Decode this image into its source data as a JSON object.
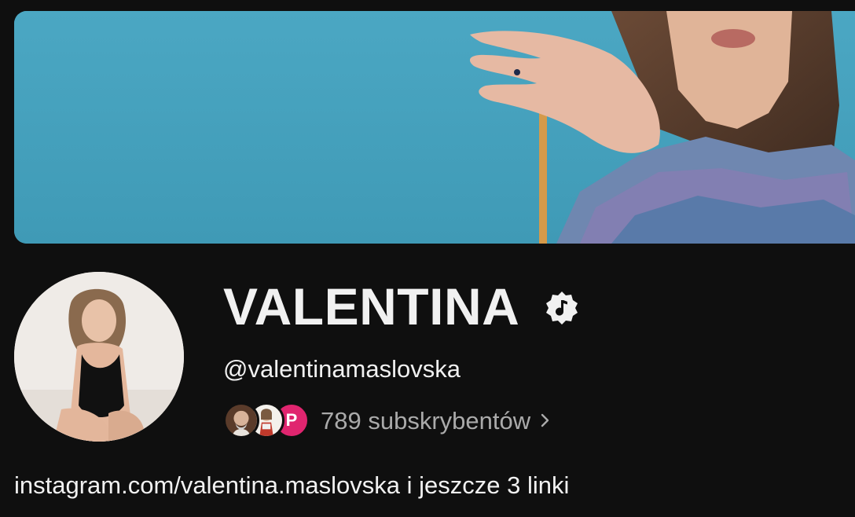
{
  "channel": {
    "name": "VALENTINA",
    "handle": "@valentinamaslovska",
    "badge_icon": "music-note-artist-badge-icon",
    "subscribers_text": "789 subskrybentów",
    "subscriber_avatars": [
      "subscriber-avatar-1",
      "subscriber-avatar-2",
      "subscriber-avatar-3"
    ],
    "subscriber_avatar_3_letter": "P",
    "links": {
      "primary_url": "instagram.com/valentina.maslovska",
      "more_text": " i jeszcze 3 linki"
    }
  },
  "colors": {
    "background": "#0f0f0f",
    "text_primary": "#f1f1f1",
    "text_secondary": "#aaaaaa",
    "banner_sky": "#4aa3bf",
    "subscriber_pink": "#e0256f"
  }
}
